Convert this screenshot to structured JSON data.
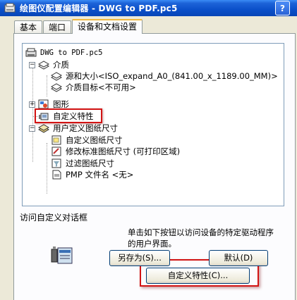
{
  "window": {
    "title": "绘图仪配置编辑器 - DWG to PDF.pc5",
    "help_button": "?"
  },
  "tabs": [
    {
      "label": "基本"
    },
    {
      "label": "端口"
    },
    {
      "label": "设备和文档设置"
    }
  ],
  "tree": {
    "root": "DWG to PDF.pc5",
    "media": "介质",
    "source_size": "源和大小<ISO_expand_A0_(841.00_x_1189.00_MM)>",
    "media_destination": "介质目标<不可用>",
    "graphics": "图形",
    "custom_properties": "自定义特性",
    "user_paper_sizes": "用户定义图纸尺寸",
    "custom_paper_sizes": "自定义图纸尺寸",
    "modify_standard_sizes": "修改标准图纸尺寸 (可打印区域)",
    "filter_paper_sizes": "过滤图纸尺寸",
    "pmp_filename": "PMP 文件名 <无>",
    "expander_minus": "−",
    "expander_plus": "+"
  },
  "group": {
    "label": "访问自定义对话框",
    "description": "单击如下按钮以访问设备的特定驱动程序的用户界面。",
    "custom_button": "自定义特性(C)..."
  },
  "buttons": {
    "save_as": "另存为(S)...",
    "default": "默认(D)"
  },
  "colors": {
    "titlebar": "#0a4fc9",
    "highlight": "#d21414",
    "tab_accent": "#f1b83e"
  }
}
